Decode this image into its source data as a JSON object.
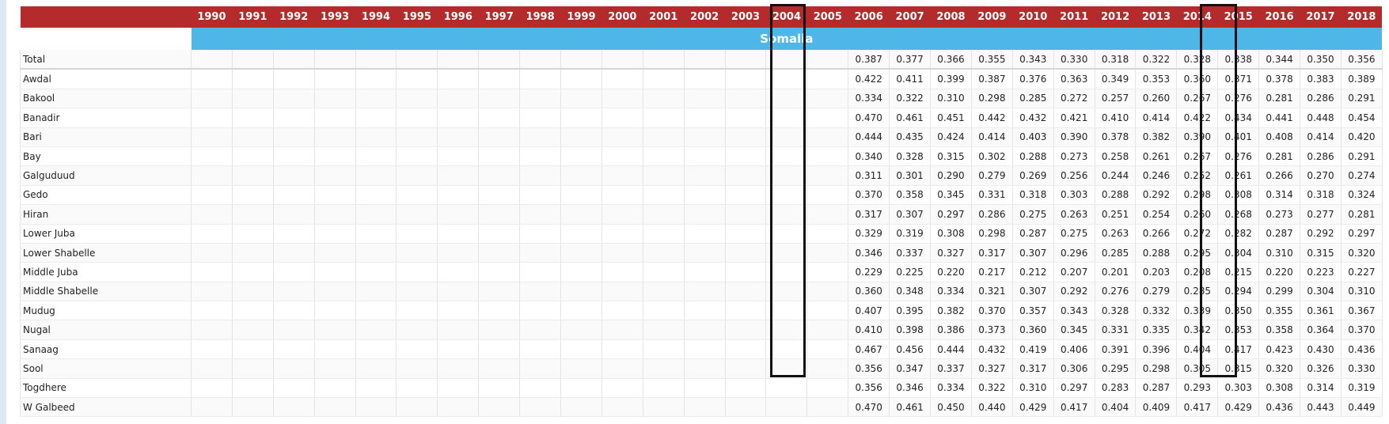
{
  "table": {
    "region_label": "Somalia",
    "years": [
      "1990",
      "1991",
      "1992",
      "1993",
      "1994",
      "1995",
      "1996",
      "1997",
      "1998",
      "1999",
      "2000",
      "2001",
      "2002",
      "2003",
      "2004",
      "2005",
      "2006",
      "2007",
      "2008",
      "2009",
      "2010",
      "2011",
      "2012",
      "2013",
      "2014",
      "2015",
      "2016",
      "2017",
      "2018"
    ],
    "highlighted_years": [
      "2006",
      "2018"
    ],
    "header_color": "#b52a2a",
    "region_color": "#4fb7e8",
    "rows": [
      {
        "name": "Total",
        "values": [
          "0.387",
          "0.377",
          "0.366",
          "0.355",
          "0.343",
          "0.330",
          "0.318",
          "0.322",
          "0.328",
          "0.338",
          "0.344",
          "0.350",
          "0.356"
        ]
      },
      {
        "name": "Awdal",
        "values": [
          "0.422",
          "0.411",
          "0.399",
          "0.387",
          "0.376",
          "0.363",
          "0.349",
          "0.353",
          "0.360",
          "0.371",
          "0.378",
          "0.383",
          "0.389"
        ]
      },
      {
        "name": "Bakool",
        "values": [
          "0.334",
          "0.322",
          "0.310",
          "0.298",
          "0.285",
          "0.272",
          "0.257",
          "0.260",
          "0.267",
          "0.276",
          "0.281",
          "0.286",
          "0.291"
        ]
      },
      {
        "name": "Banadir",
        "values": [
          "0.470",
          "0.461",
          "0.451",
          "0.442",
          "0.432",
          "0.421",
          "0.410",
          "0.414",
          "0.422",
          "0.434",
          "0.441",
          "0.448",
          "0.454"
        ]
      },
      {
        "name": "Bari",
        "values": [
          "0.444",
          "0.435",
          "0.424",
          "0.414",
          "0.403",
          "0.390",
          "0.378",
          "0.382",
          "0.390",
          "0.401",
          "0.408",
          "0.414",
          "0.420"
        ]
      },
      {
        "name": "Bay",
        "values": [
          "0.340",
          "0.328",
          "0.315",
          "0.302",
          "0.288",
          "0.273",
          "0.258",
          "0.261",
          "0.267",
          "0.276",
          "0.281",
          "0.286",
          "0.291"
        ]
      },
      {
        "name": "Galguduud",
        "values": [
          "0.311",
          "0.301",
          "0.290",
          "0.279",
          "0.269",
          "0.256",
          "0.244",
          "0.246",
          "0.252",
          "0.261",
          "0.266",
          "0.270",
          "0.274"
        ]
      },
      {
        "name": "Gedo",
        "values": [
          "0.370",
          "0.358",
          "0.345",
          "0.331",
          "0.318",
          "0.303",
          "0.288",
          "0.292",
          "0.298",
          "0.308",
          "0.314",
          "0.318",
          "0.324"
        ]
      },
      {
        "name": "Hiran",
        "values": [
          "0.317",
          "0.307",
          "0.297",
          "0.286",
          "0.275",
          "0.263",
          "0.251",
          "0.254",
          "0.260",
          "0.268",
          "0.273",
          "0.277",
          "0.281"
        ]
      },
      {
        "name": "Lower Juba",
        "values": [
          "0.329",
          "0.319",
          "0.308",
          "0.298",
          "0.287",
          "0.275",
          "0.263",
          "0.266",
          "0.272",
          "0.282",
          "0.287",
          "0.292",
          "0.297"
        ]
      },
      {
        "name": "Lower Shabelle",
        "values": [
          "0.346",
          "0.337",
          "0.327",
          "0.317",
          "0.307",
          "0.296",
          "0.285",
          "0.288",
          "0.295",
          "0.304",
          "0.310",
          "0.315",
          "0.320"
        ]
      },
      {
        "name": "Middle Juba",
        "values": [
          "0.229",
          "0.225",
          "0.220",
          "0.217",
          "0.212",
          "0.207",
          "0.201",
          "0.203",
          "0.208",
          "0.215",
          "0.220",
          "0.223",
          "0.227"
        ]
      },
      {
        "name": "Middle Shabelle",
        "values": [
          "0.360",
          "0.348",
          "0.334",
          "0.321",
          "0.307",
          "0.292",
          "0.276",
          "0.279",
          "0.285",
          "0.294",
          "0.299",
          "0.304",
          "0.310"
        ]
      },
      {
        "name": "Mudug",
        "values": [
          "0.407",
          "0.395",
          "0.382",
          "0.370",
          "0.357",
          "0.343",
          "0.328",
          "0.332",
          "0.339",
          "0.350",
          "0.355",
          "0.361",
          "0.367"
        ]
      },
      {
        "name": "Nugal",
        "values": [
          "0.410",
          "0.398",
          "0.386",
          "0.373",
          "0.360",
          "0.345",
          "0.331",
          "0.335",
          "0.342",
          "0.353",
          "0.358",
          "0.364",
          "0.370"
        ]
      },
      {
        "name": "Sanaag",
        "values": [
          "0.467",
          "0.456",
          "0.444",
          "0.432",
          "0.419",
          "0.406",
          "0.391",
          "0.396",
          "0.404",
          "0.417",
          "0.423",
          "0.430",
          "0.436"
        ]
      },
      {
        "name": "Sool",
        "values": [
          "0.356",
          "0.347",
          "0.337",
          "0.327",
          "0.317",
          "0.306",
          "0.295",
          "0.298",
          "0.305",
          "0.315",
          "0.320",
          "0.326",
          "0.330"
        ]
      },
      {
        "name": "Togdhere",
        "values": [
          "0.356",
          "0.346",
          "0.334",
          "0.322",
          "0.310",
          "0.297",
          "0.283",
          "0.287",
          "0.293",
          "0.303",
          "0.308",
          "0.314",
          "0.319"
        ]
      },
      {
        "name": "W Galbeed",
        "values": [
          "0.470",
          "0.461",
          "0.450",
          "0.440",
          "0.429",
          "0.417",
          "0.404",
          "0.409",
          "0.417",
          "0.429",
          "0.436",
          "0.443",
          "0.449"
        ]
      }
    ]
  }
}
